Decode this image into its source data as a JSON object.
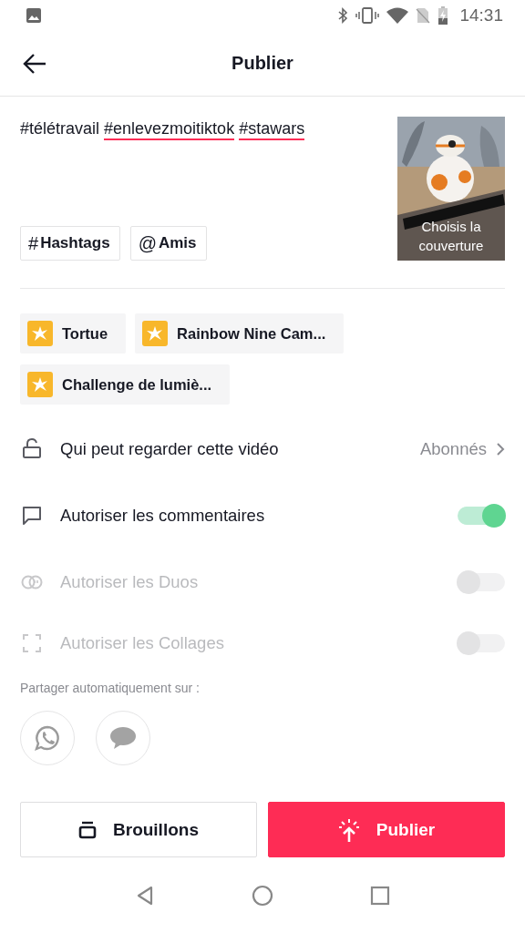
{
  "status_bar": {
    "time": "14:31"
  },
  "header": {
    "title": "Publier"
  },
  "caption": {
    "parts": [
      {
        "text": "#télétravail",
        "underlined": false
      },
      {
        "text": "#enlevezmoitiktok",
        "underlined": true
      },
      {
        "text": "#stawars",
        "underlined": true
      }
    ]
  },
  "caption_buttons": [
    {
      "symbol": "#",
      "label": "Hashtags"
    },
    {
      "symbol": "@",
      "label": "Amis"
    }
  ],
  "cover": {
    "kind": "picture",
    "label": "Choisis la couverture"
  },
  "effects": [
    {
      "label": "Tortue"
    },
    {
      "label": "Rainbow Nine Cam..."
    },
    {
      "label": "Challenge de lumiè..."
    }
  ],
  "settings": [
    {
      "kind": "link",
      "label": "Qui peut regarder cette vidéo",
      "value": "Abonnés"
    },
    {
      "kind": "toggle",
      "label": "Autoriser les commentaires",
      "on": true,
      "disabled": false
    },
    {
      "kind": "toggle",
      "label": "Autoriser les Duos",
      "on": false,
      "disabled": true
    },
    {
      "kind": "toggle",
      "label": "Autoriser les Collages",
      "on": false,
      "disabled": true
    }
  ],
  "share": {
    "label": "Partager automatiquement sur :",
    "targets": [
      {
        "kind": "whatsapp"
      },
      {
        "kind": "message"
      }
    ]
  },
  "buttons": [
    {
      "kind": "drafts",
      "label": "Brouillons"
    },
    {
      "kind": "publish",
      "label": "Publier"
    }
  ]
}
